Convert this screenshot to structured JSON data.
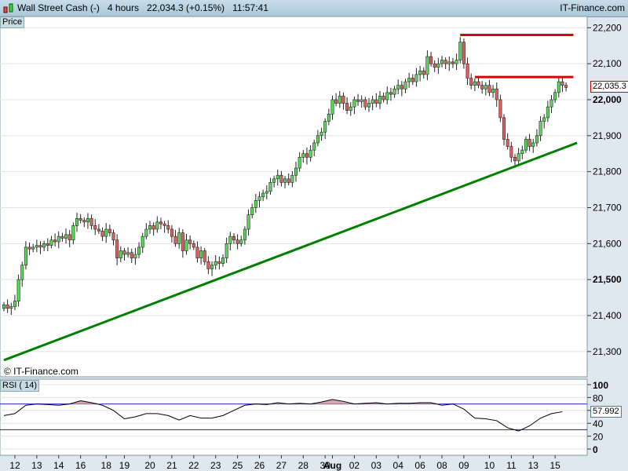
{
  "header": {
    "instrument": "Wall Street Cash (-)",
    "timeframe": "4 hours",
    "price": "22,034.3",
    "change": "(+0.15%)",
    "time": "11:57:41",
    "brand": "IT-Finance.com"
  },
  "price_panel": {
    "label": "Price",
    "watermark": "© IT-Finance.com",
    "last_price": "22,035.3",
    "yticks": [
      {
        "v": 22200,
        "t": "22,200"
      },
      {
        "v": 22100,
        "t": "22,100"
      },
      {
        "v": 22000,
        "t": "22,000"
      },
      {
        "v": 21900,
        "t": "21,900"
      },
      {
        "v": 21800,
        "t": "21,800"
      },
      {
        "v": 21700,
        "t": "21,700"
      },
      {
        "v": 21600,
        "t": "21,600"
      },
      {
        "v": 21500,
        "t": "21,500"
      },
      {
        "v": 21400,
        "t": "21,400"
      },
      {
        "v": 21300,
        "t": "21,300"
      }
    ],
    "resistance_lines": [
      {
        "from_bar": 125,
        "to_bar": 156,
        "price": 22180,
        "color": "#e00000"
      },
      {
        "from_bar": 129,
        "to_bar": 156,
        "price": 22063,
        "color": "#e00000"
      }
    ],
    "trendline": {
      "from_bar": 0,
      "to_bar": 157,
      "from_price": 21276,
      "to_price": 21880,
      "color": "#008000"
    },
    "closes": [
      21430,
      21420,
      21425,
      21440,
      21500,
      21540,
      21590,
      21585,
      21590,
      21595,
      21590,
      21600,
      21595,
      21610,
      21605,
      21620,
      21615,
      21625,
      21610,
      21650,
      21670,
      21665,
      21660,
      21670,
      21650,
      21640,
      21635,
      21620,
      21640,
      21630,
      21610,
      21560,
      21580,
      21570,
      21575,
      21560,
      21570,
      21590,
      21620,
      21640,
      21650,
      21640,
      21660,
      21655,
      21650,
      21640,
      21620,
      21600,
      21630,
      21580,
      21610,
      21600,
      21590,
      21560,
      21580,
      21550,
      21530,
      21540,
      21550,
      21545,
      21560,
      21600,
      21620,
      21610,
      21600,
      21610,
      21640,
      21680,
      21700,
      21720,
      21730,
      21740,
      21745,
      21770,
      21780,
      21790,
      21770,
      21780,
      21770,
      21790,
      21810,
      21840,
      21850,
      21840,
      21860,
      21880,
      21900,
      21910,
      21940,
      21960,
      22000,
      21990,
      22010,
      21990,
      21970,
      21980,
      22000,
      21995,
      22000,
      21980,
      21990,
      22000,
      21990,
      22010,
      22000,
      22020,
      22015,
      22030,
      22040,
      22030,
      22050,
      22060,
      22050,
      22070,
      22080,
      22070,
      22120,
      22100,
      22090,
      22100,
      22110,
      22100,
      22105,
      22100,
      22110,
      22160,
      22100,
      22060,
      22040,
      22050,
      22040,
      22030,
      22040,
      22020,
      22030,
      22000,
      21950,
      21890,
      21870,
      21840,
      21830,
      21850,
      21860,
      21890,
      21870,
      21880,
      21900,
      21940,
      21950,
      21980,
      22000,
      22020,
      22050,
      22040,
      22034
    ]
  },
  "rsi_panel": {
    "label": "RSI ( 14)",
    "last_value": "57.992",
    "yticks": [
      "100",
      "80",
      "60",
      "40",
      "20",
      "0"
    ],
    "levels": [
      70,
      30
    ],
    "values_every_3_bars": [
      52,
      55,
      68,
      70,
      69,
      68,
      70,
      75,
      72,
      68,
      60,
      47,
      50,
      55,
      55,
      52,
      45,
      52,
      48,
      48,
      52,
      60,
      68,
      70,
      69,
      72,
      70,
      71,
      70,
      73,
      77,
      74,
      70,
      71,
      72,
      70,
      71,
      71,
      72,
      72,
      68,
      70,
      62,
      48,
      47,
      44,
      33,
      28,
      36,
      48,
      55,
      58
    ]
  },
  "time_axis": [
    {
      "x": "12",
      "b": 3
    },
    {
      "x": "13",
      "b": 9
    },
    {
      "x": "14",
      "b": 15
    },
    {
      "x": "16",
      "b": 21
    },
    {
      "x": "18",
      "b": 28
    },
    {
      "x": "19",
      "b": 33
    },
    {
      "x": "20",
      "b": 40
    },
    {
      "x": "21",
      "b": 46
    },
    {
      "x": "22",
      "b": 52
    },
    {
      "x": "23",
      "b": 58
    },
    {
      "x": "25",
      "b": 64
    },
    {
      "x": "26",
      "b": 70
    },
    {
      "x": "27",
      "b": 76
    },
    {
      "x": "28",
      "b": 82
    },
    {
      "x": "30",
      "b": 88
    },
    {
      "x": "Aug",
      "b": 90
    },
    {
      "x": "02",
      "b": 96
    },
    {
      "x": "03",
      "b": 102
    },
    {
      "x": "04",
      "b": 108
    },
    {
      "x": "06",
      "b": 114
    },
    {
      "x": "08",
      "b": 120
    },
    {
      "x": "09",
      "b": 126
    },
    {
      "x": "10",
      "b": 133
    },
    {
      "x": "11",
      "b": 139
    },
    {
      "x": "13",
      "b": 145
    },
    {
      "x": "15",
      "b": 151
    }
  ]
}
